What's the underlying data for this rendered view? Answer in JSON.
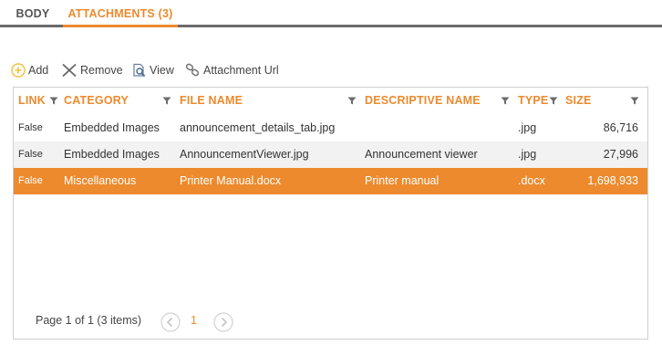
{
  "tabs": [
    {
      "label": "BODY"
    },
    {
      "label": "ATTACHMENTS (3)"
    }
  ],
  "toolbar": {
    "add_label": "Add",
    "remove_label": "Remove",
    "view_label": "View",
    "url_label": "Attachment Url"
  },
  "grid": {
    "columns": [
      {
        "label": "LINK"
      },
      {
        "label": "CATEGORY"
      },
      {
        "label": "FILE NAME"
      },
      {
        "label": "DESCRIPTIVE NAME"
      },
      {
        "label": "TYPE"
      },
      {
        "label": "SIZE"
      }
    ],
    "rows": [
      {
        "link": "False",
        "category": "Embedded Images",
        "file_name": "announcement_details_tab.jpg",
        "descriptive_name": "",
        "type": ".jpg",
        "size": "86,716"
      },
      {
        "link": "False",
        "category": "Embedded Images",
        "file_name": "AnnouncementViewer.jpg",
        "descriptive_name": "Announcement viewer",
        "type": ".jpg",
        "size": "27,996"
      },
      {
        "link": "False",
        "category": "Miscellaneous",
        "file_name": "Printer Manual.docx",
        "descriptive_name": "Printer manual",
        "type": ".docx",
        "size": "1,698,933"
      }
    ],
    "selected_row": 3
  },
  "pager": {
    "info": "Page 1 of 1 (3 items)",
    "current_page": "1"
  },
  "colors": {
    "accent": "#ec8a2d",
    "tab_rule": "#6b6b6b",
    "row_alt": "#f2f2f2",
    "add_icon": "#f2c13a"
  },
  "icons": {
    "add": "plus-circle-icon",
    "remove": "x-icon",
    "view": "magnifier-document-icon",
    "url": "link-icon",
    "filter": "funnel-icon",
    "prev": "chevron-left-circle-icon",
    "next": "chevron-right-circle-icon"
  }
}
